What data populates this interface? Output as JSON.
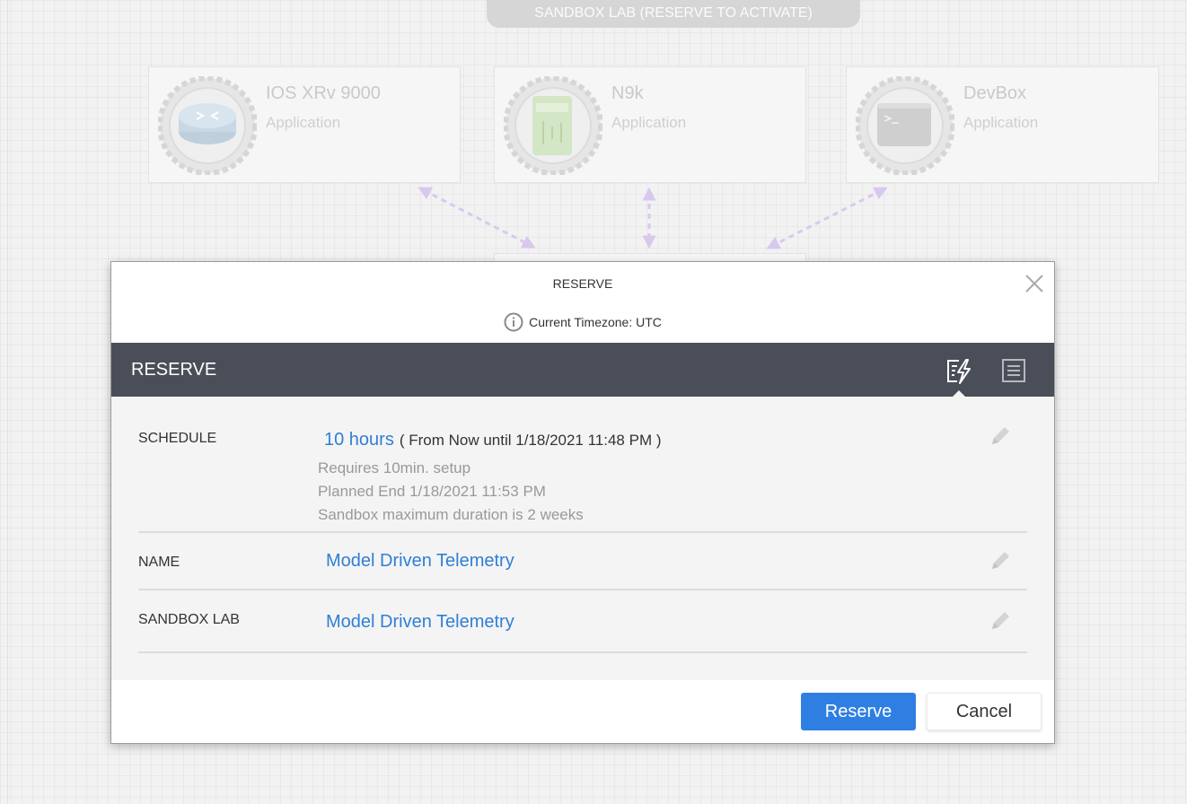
{
  "canvas": {
    "banner": "SANDBOX LAB (RESERVE TO ACTIVATE)",
    "nodes": [
      {
        "title": "IOS XRv 9000",
        "subtitle": "Application",
        "icon": "router-icon"
      },
      {
        "title": "N9k",
        "subtitle": "Application",
        "icon": "switch-icon"
      },
      {
        "title": "DevBox",
        "subtitle": "Application",
        "icon": "terminal-icon"
      }
    ]
  },
  "modal": {
    "title": "RESERVE",
    "timezone": "Current Timezone: UTC",
    "bar_title": "RESERVE",
    "bar_icons": [
      "quick-reserve-icon",
      "list-view-icon"
    ],
    "schedule": {
      "label": "SCHEDULE",
      "duration": "10 hours",
      "range": "( From Now until 1/18/2021 11:48 PM )",
      "notes": [
        "Requires 10min. setup",
        "Planned End 1/18/2021 11:53 PM",
        "Sandbox maximum duration is 2 weeks"
      ]
    },
    "name": {
      "label": "NAME",
      "value": "Model Driven Telemetry"
    },
    "sandbox_lab": {
      "label": "SANDBOX LAB",
      "value": "Model Driven Telemetry"
    },
    "buttons": {
      "reserve": "Reserve",
      "cancel": "Cancel"
    }
  },
  "colors": {
    "accent": "#2f7fe2",
    "link": "#2f7fd6",
    "bar": "#4a4e58"
  }
}
